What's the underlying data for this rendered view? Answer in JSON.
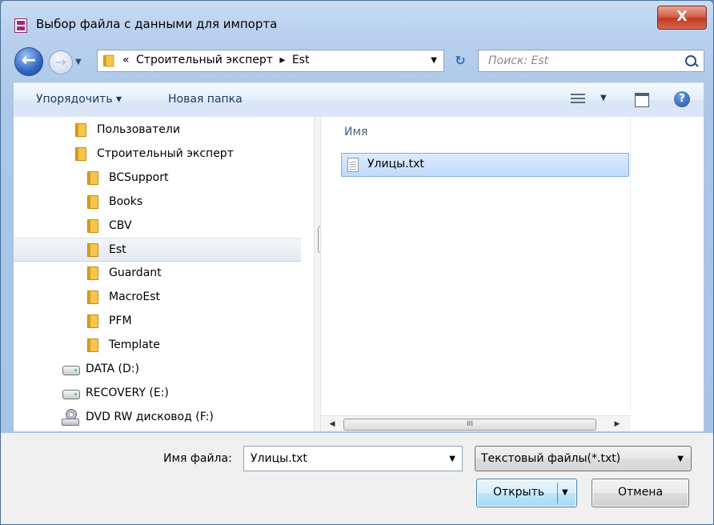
{
  "window": {
    "title": "Выбор файла с данными для импорта",
    "close_label": "X"
  },
  "nav": {
    "back_icon": "back-arrow-icon",
    "forward_icon": "forward-arrow-icon",
    "breadcrumb": [
      "«",
      "Строительный эксперт",
      "▸",
      "Est"
    ],
    "refresh_icon": "refresh-icon",
    "search_placeholder": "Поиск: Est"
  },
  "toolbar": {
    "organize_label": "Упорядочить ▾",
    "new_folder_label": "Новая папка",
    "help_label": "?"
  },
  "tree": {
    "items": [
      {
        "label": "Пользователи",
        "icon": "folder-icon"
      },
      {
        "label": "Строительный эксперт",
        "icon": "folder-icon"
      },
      {
        "label": "BCSupport",
        "icon": "folder-icon"
      },
      {
        "label": "Books",
        "icon": "folder-icon"
      },
      {
        "label": "CBV",
        "icon": "folder-icon"
      },
      {
        "label": "Est",
        "icon": "folder-icon",
        "selected": true
      },
      {
        "label": "Guardant",
        "icon": "folder-icon"
      },
      {
        "label": "MacroEst",
        "icon": "folder-icon"
      },
      {
        "label": "PFM",
        "icon": "folder-icon"
      },
      {
        "label": "Template",
        "icon": "folder-icon"
      },
      {
        "label": "DATA (D:)",
        "icon": "drive-icon"
      },
      {
        "label": "RECOVERY (E:)",
        "icon": "drive-icon"
      },
      {
        "label": "DVD RW дисковод (F:)",
        "icon": "dvd-drive-icon"
      }
    ]
  },
  "files": {
    "column_header": "Имя",
    "items": [
      {
        "name": "Улицы.txt",
        "icon": "text-file-icon",
        "selected": true
      }
    ]
  },
  "bottom": {
    "filename_label": "Имя файла:",
    "filename_value": "Улицы.txt",
    "filetype_value": "Текстовый файлы(*.txt)",
    "open_label": "Открыть",
    "cancel_label": "Отмена"
  }
}
